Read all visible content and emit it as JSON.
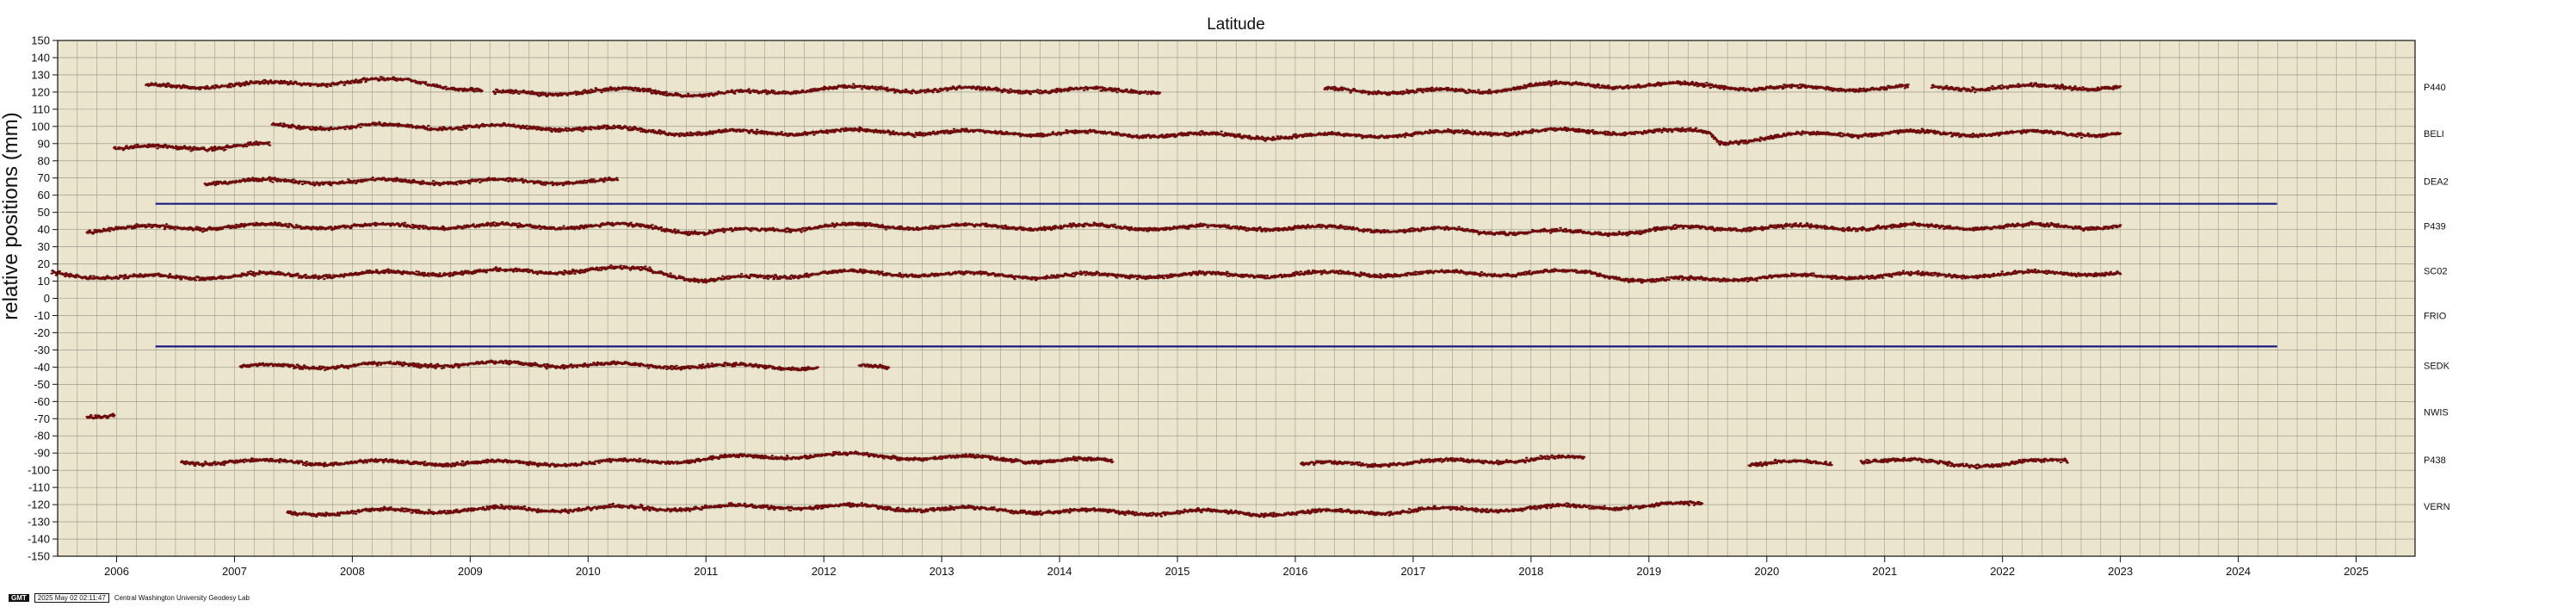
{
  "chart_data": {
    "type": "scatter",
    "title": "Latitude",
    "ylabel": "relative positions (mm)",
    "xlim": [
      2005.5,
      2025.5
    ],
    "ylim": [
      -150,
      150
    ],
    "yticks": [
      150,
      140,
      130,
      120,
      110,
      100,
      90,
      80,
      70,
      60,
      50,
      40,
      30,
      20,
      10,
      0,
      -10,
      -20,
      -30,
      -40,
      -50,
      -60,
      -70,
      -80,
      -90,
      -100,
      -110,
      -120,
      -130,
      -140,
      -150
    ],
    "xticks": [
      2006,
      2007,
      2008,
      2009,
      2010,
      2011,
      2012,
      2013,
      2014,
      2015,
      2016,
      2017,
      2018,
      2019,
      2020,
      2021,
      2022,
      2023,
      2024,
      2025
    ],
    "grid": true,
    "reference_lines": [
      {
        "y": 55,
        "x": [
          2006.33,
          2024.33
        ]
      },
      {
        "y": -28,
        "x": [
          2006.33,
          2024.33
        ]
      }
    ],
    "series": [
      {
        "name": "P440",
        "label_y": 123,
        "baseline": 123,
        "segments": [
          [
            2006.25,
            2009.1
          ],
          [
            2009.2,
            2014.85
          ],
          [
            2016.25,
            2021.2
          ],
          [
            2021.4,
            2023.0
          ]
        ],
        "trend": [
          [
            2006.25,
            123
          ],
          [
            2007.5,
            125
          ],
          [
            2008.5,
            127
          ],
          [
            2009.2,
            119
          ],
          [
            2010.5,
            121
          ],
          [
            2011.0,
            118
          ],
          [
            2012.0,
            122
          ],
          [
            2014.0,
            121
          ],
          [
            2016.25,
            121
          ],
          [
            2017.5,
            120
          ],
          [
            2018.0,
            124
          ],
          [
            2019.5,
            124
          ],
          [
            2020.0,
            122
          ],
          [
            2023.0,
            123
          ]
        ]
      },
      {
        "name": "BELI",
        "label_y": 96,
        "baseline": 96,
        "segments": [
          [
            2005.98,
            2007.3
          ],
          [
            2007.32,
            2023.0
          ]
        ],
        "trend": [
          [
            2005.98,
            87
          ],
          [
            2007.3,
            89
          ],
          [
            2007.32,
            100
          ],
          [
            2008.5,
            100
          ],
          [
            2010.0,
            99
          ],
          [
            2011.0,
            96
          ],
          [
            2012.0,
            97
          ],
          [
            2014.0,
            96
          ],
          [
            2016.0,
            94
          ],
          [
            2018.0,
            97
          ],
          [
            2019.5,
            97
          ],
          [
            2019.6,
            91
          ],
          [
            2020.5,
            96
          ],
          [
            2023.0,
            96
          ]
        ]
      },
      {
        "name": "DEA2",
        "label_y": 68,
        "baseline": 68,
        "segments": [
          [
            2006.75,
            2010.25
          ]
        ],
        "trend": [
          [
            2006.75,
            68
          ],
          [
            2010.25,
            68
          ]
        ]
      },
      {
        "name": "P439",
        "label_y": 42,
        "baseline": 42,
        "segments": [
          [
            2005.75,
            2023.0
          ]
        ],
        "trend": [
          [
            2005.75,
            40
          ],
          [
            2007.0,
            42
          ],
          [
            2010.5,
            42
          ],
          [
            2011.0,
            38
          ],
          [
            2012.0,
            42
          ],
          [
            2016.0,
            41
          ],
          [
            2018.5,
            38
          ],
          [
            2019.5,
            41
          ],
          [
            2023.0,
            42
          ]
        ]
      },
      {
        "name": "SC02",
        "label_y": 16,
        "baseline": 16,
        "segments": [
          [
            2005.45,
            2023.0
          ]
        ],
        "trend": [
          [
            2005.45,
            15
          ],
          [
            2006.0,
            12
          ],
          [
            2008.0,
            14
          ],
          [
            2010.5,
            17
          ],
          [
            2011.0,
            10
          ],
          [
            2012.0,
            15
          ],
          [
            2014.0,
            13
          ],
          [
            2018.5,
            15
          ],
          [
            2019.0,
            10
          ],
          [
            2019.8,
            12
          ],
          [
            2023.0,
            15
          ]
        ]
      },
      {
        "name": "FRIO",
        "label_y": -10,
        "baseline": null,
        "segments": [],
        "trend": []
      },
      {
        "name": "SEDK",
        "label_y": -39,
        "baseline": -40,
        "segments": [
          [
            2007.05,
            2011.95
          ],
          [
            2012.3,
            2012.55
          ]
        ],
        "trend": [
          [
            2007.05,
            -40
          ],
          [
            2009.0,
            -38
          ],
          [
            2011.95,
            -40
          ],
          [
            2012.3,
            -40
          ],
          [
            2012.55,
            -40
          ]
        ]
      },
      {
        "name": "NWIS",
        "label_y": -66,
        "baseline": -68,
        "segments": [
          [
            2005.75,
            2005.98
          ]
        ],
        "trend": [
          [
            2005.75,
            -68
          ],
          [
            2005.98,
            -68
          ]
        ]
      },
      {
        "name": "P438",
        "label_y": -94,
        "baseline": -95,
        "segments": [
          [
            2006.55,
            2014.45
          ],
          [
            2016.05,
            2018.45
          ],
          [
            2019.85,
            2020.55
          ],
          [
            2020.8,
            2022.55
          ]
        ],
        "trend": [
          [
            2006.55,
            -95
          ],
          [
            2010.0,
            -96
          ],
          [
            2012.0,
            -91
          ],
          [
            2014.45,
            -95
          ],
          [
            2016.05,
            -97
          ],
          [
            2018.45,
            -93
          ],
          [
            2019.85,
            -96
          ],
          [
            2020.55,
            -96
          ],
          [
            2020.8,
            -94
          ],
          [
            2022.0,
            -97
          ],
          [
            2022.55,
            -94
          ]
        ]
      },
      {
        "name": "VERN",
        "label_y": -121,
        "baseline": -122,
        "segments": [
          [
            2007.45,
            2019.45
          ]
        ],
        "trend": [
          [
            2007.45,
            -125
          ],
          [
            2009.0,
            -123
          ],
          [
            2012.0,
            -121
          ],
          [
            2014.0,
            -124
          ],
          [
            2016.0,
            -125
          ],
          [
            2018.0,
            -122
          ],
          [
            2019.45,
            -120
          ]
        ]
      }
    ]
  },
  "footer": {
    "logo": "GMT",
    "timestamp": "2025 May 02 02:11:47",
    "credit": "Central Washington University Geodesy Lab"
  },
  "colors": {
    "plot_bg": "#ebe5cd",
    "grid": "#8f8d80",
    "points": "#6e0a0a",
    "errors": "#a8a8a8",
    "reference_line": "#1a1a80"
  }
}
